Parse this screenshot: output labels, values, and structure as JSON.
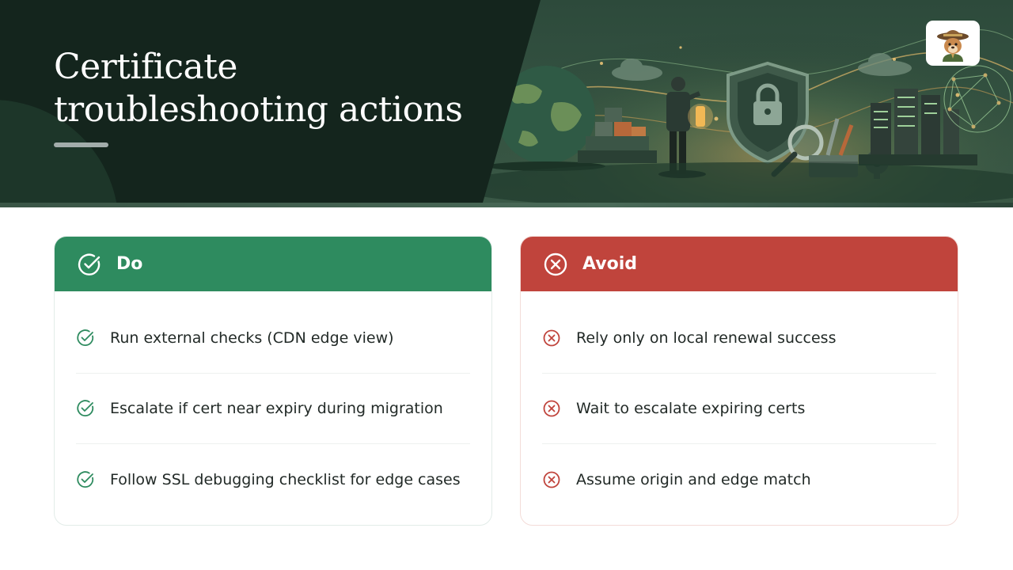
{
  "slide": {
    "title_lines": [
      "Certificate",
      "troubleshooting actions"
    ]
  },
  "colors": {
    "banner_dark": "#14251d",
    "do_accent": "#2e8b5f",
    "avoid_accent": "#c0443c",
    "title_text": "#ffffff",
    "body_text": "#222a27"
  },
  "banner": {
    "illustration_icons": [
      "globe-icon",
      "blocks-icon",
      "lantern-person-icon",
      "shield-lock-icon",
      "magnifier-icon",
      "toolbox-icon",
      "gear-icon",
      "server-rack-icon",
      "network-icon",
      "cloud-icon"
    ],
    "logo_icon": "ranger-mascot-icon"
  },
  "do_card": {
    "header_icon": "check-circle-icon",
    "title": "Do",
    "items": [
      {
        "icon": "check-circle-icon",
        "text": "Run external checks (CDN edge view)"
      },
      {
        "icon": "check-circle-icon",
        "text": "Escalate if cert near expiry during migration"
      },
      {
        "icon": "check-circle-icon",
        "text": "Follow SSL debugging checklist for edge cases"
      }
    ]
  },
  "avoid_card": {
    "header_icon": "x-circle-icon",
    "title": "Avoid",
    "items": [
      {
        "icon": "x-circle-icon",
        "text": "Rely only on local renewal success"
      },
      {
        "icon": "x-circle-icon",
        "text": "Wait to escalate expiring certs"
      },
      {
        "icon": "x-circle-icon",
        "text": "Assume origin and edge match"
      }
    ]
  }
}
